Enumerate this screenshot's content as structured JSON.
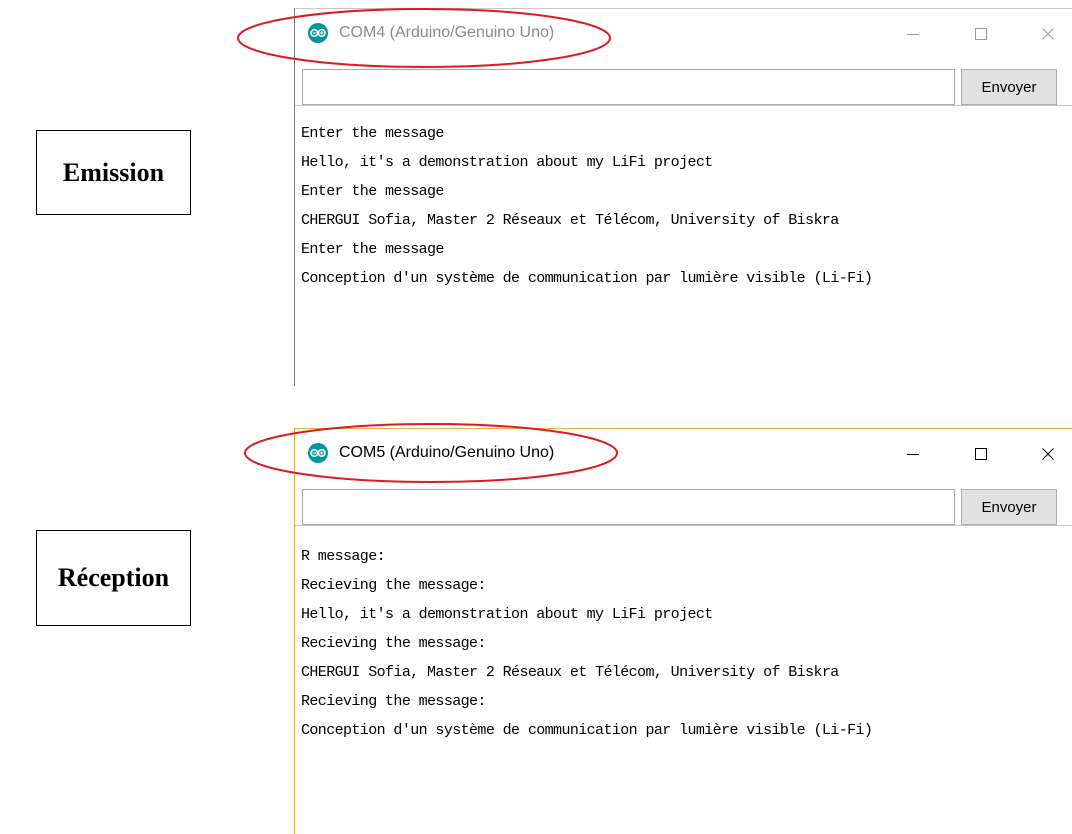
{
  "labels": {
    "emission": "Emission",
    "reception": "Réception"
  },
  "windows": [
    {
      "title": "COM4 (Arduino/Genuino Uno)",
      "icon": "arduino-icon",
      "input_value": "",
      "send_label": "Envoyer",
      "controls": [
        "minimize-icon",
        "maximize-icon",
        "close-icon"
      ],
      "output_lines": [
        "Enter the message",
        "Hello, it's a demonstration about my LiFi project",
        "Enter the message",
        "CHERGUI Sofia, Master 2 Réseaux et Télécom, University of Biskra",
        "Enter the message",
        "Conception d'un système de communication par lumière visible (Li-Fi)"
      ]
    },
    {
      "title": "COM5 (Arduino/Genuino Uno)",
      "icon": "arduino-icon",
      "input_value": "",
      "send_label": "Envoyer",
      "controls": [
        "minimize-icon",
        "maximize-icon",
        "close-icon"
      ],
      "output_lines": [
        "R message:",
        "Recieving the message:",
        "Hello, it's a demonstration about my LiFi project",
        "Recieving the message:",
        "CHERGUI Sofia, Master 2 Réseaux et Télécom, University of Biskra",
        "Recieving the message:",
        "Conception d'un système de communication par lumière visible (Li-Fi)"
      ]
    }
  ],
  "colors": {
    "annotation_ellipse": "#e0191f",
    "arduino_teal": "#00979c",
    "active_border": "#e8b04a"
  }
}
